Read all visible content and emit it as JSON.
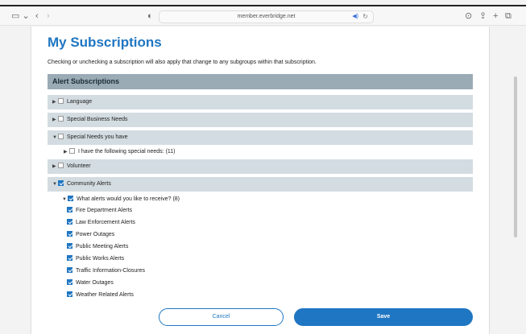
{
  "browser": {
    "url": "member.everbridge.net"
  },
  "page": {
    "title": "My Subscriptions",
    "description": "Checking or unchecking a subscription will also apply that change to any subgroups within that subscription.",
    "section_header": "Alert Subscriptions"
  },
  "groups": [
    {
      "label": "Language",
      "expanded": false,
      "checked": false
    },
    {
      "label": "Special Business Needs",
      "expanded": false,
      "checked": false
    },
    {
      "label": "Special Needs you have",
      "expanded": true,
      "checked": false,
      "sub": "I have the following special needs: (11)"
    },
    {
      "label": "Volunteer",
      "expanded": false,
      "checked": false
    },
    {
      "label": "Community Alerts",
      "expanded": true,
      "checked": true,
      "sub": "What alerts would you like to receive? (8)"
    }
  ],
  "alerts": [
    "Fire Department Alerts",
    "Law Enforcement Alerts",
    "Power Outages",
    "Public Meeting Alerts",
    "Public Works Alerts",
    "Traffic Information-Closures",
    "Water Outages",
    "Weather Related Alerts"
  ],
  "buttons": {
    "cancel": "Cancel",
    "save": "Save"
  }
}
